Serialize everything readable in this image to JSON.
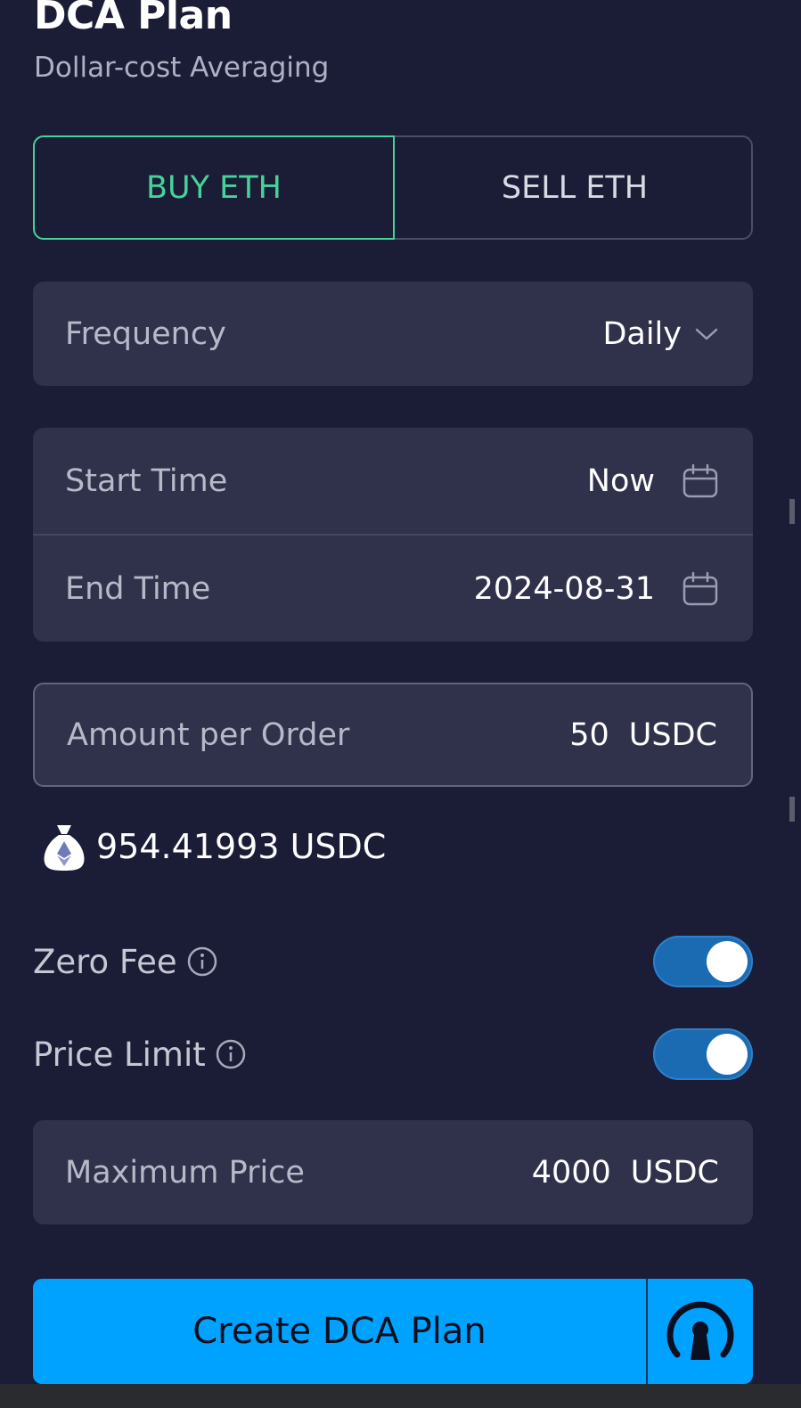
{
  "header": {
    "title": "DCA Plan",
    "subtitle": "Dollar-cost Averaging"
  },
  "tabs": {
    "buy_label": "BUY ETH",
    "sell_label": "SELL  ETH",
    "active": "buy"
  },
  "frequency": {
    "label": "Frequency",
    "value": "Daily"
  },
  "start_time": {
    "label": "Start Time",
    "value": "Now"
  },
  "end_time": {
    "label": "End Time",
    "value": "2024-08-31"
  },
  "amount": {
    "label": "Amount per Order",
    "value": "50",
    "unit": "USDC"
  },
  "balance": {
    "value": "954.41993 USDC",
    "icon": "eth-money-bag-icon"
  },
  "zero_fee": {
    "label": "Zero Fee",
    "enabled": true
  },
  "price_limit": {
    "label": "Price Limit",
    "enabled": true
  },
  "max_price": {
    "label": "Maximum Price",
    "value": "4000",
    "unit": "USDC"
  },
  "cta": {
    "label": "Create DCA Plan",
    "icon": "wallet-lock-icon"
  },
  "colors": {
    "background": "#1b1c35",
    "panel": "#30314b",
    "buy_accent": "#45d39b",
    "cta": "#00a2ff",
    "toggle_on": "#1b6bb3"
  }
}
